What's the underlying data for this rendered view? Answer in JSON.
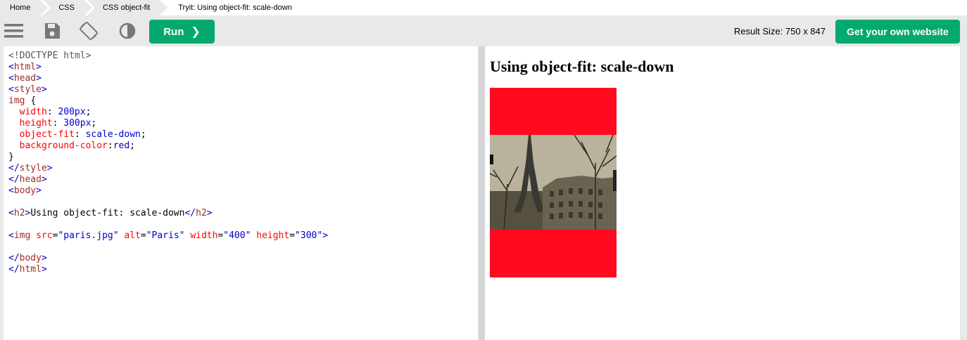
{
  "breadcrumb": {
    "items": [
      "Home",
      "CSS",
      "CSS object-fit"
    ],
    "current": "Tryit: Using object-fit: scale-down"
  },
  "toolbar": {
    "icons": [
      "menu-icon",
      "save-icon",
      "rotate-icon",
      "contrast-icon"
    ],
    "run_label": "Run",
    "run_arrow": "❯",
    "result_size": "Result Size: 750 x 847",
    "get_website_label": "Get your own website"
  },
  "code": {
    "lines": [
      "<!DOCTYPE html>",
      "<html>",
      "<head>",
      "<style>",
      "img {",
      "  width: 200px;",
      "  height: 300px;",
      "  object-fit: scale-down;",
      "  background-color:red;",
      "}",
      "</style>",
      "</head>",
      "<body>",
      "",
      "<h2>Using object-fit: scale-down</h2>",
      "",
      "<img src=\"paris.jpg\" alt=\"Paris\" width=\"400\" height=\"300\">",
      "",
      "</body>",
      "</html>"
    ]
  },
  "result": {
    "heading": "Using object-fit: scale-down",
    "image_alt": "Paris",
    "image_bg_color": "#ff0a1e"
  },
  "colors": {
    "accent": "#04aa6d",
    "toolbar_bg": "#e7e9eb"
  }
}
